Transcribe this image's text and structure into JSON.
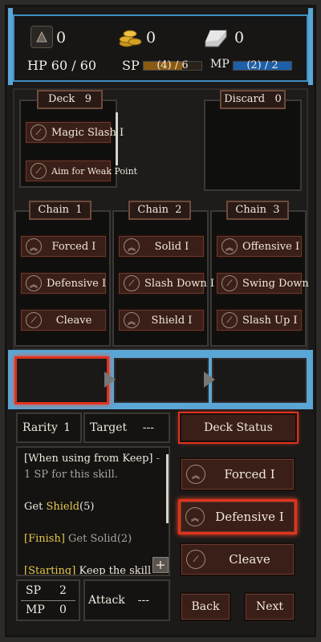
{
  "resources": {
    "gems": "0",
    "coins": "0",
    "ingots": "0"
  },
  "stats": {
    "hp_label": "HP 60 / 60",
    "sp_label": "SP",
    "sp_value": "(4) / 6",
    "sp_fill": 0.67,
    "mp_label": "MP",
    "mp_value": "(2) / 2",
    "mp_fill": 1.0,
    "colors": {
      "sp_bar": "#8a5a12",
      "mp_bar": "#1d5fa8",
      "highlight": "#e0321e",
      "frame": "#5aa6d6"
    }
  },
  "deck": {
    "label": "Deck",
    "count": "9",
    "cards": [
      {
        "name": "Magic Slash I",
        "icon": "slash-icon"
      },
      {
        "name": "Aim for Weak Point",
        "icon": "slash-icon"
      }
    ]
  },
  "discard": {
    "label": "Discard",
    "count": "0"
  },
  "chains": [
    {
      "label": "Chain",
      "num": "1",
      "cards": [
        {
          "name": "Forced I",
          "icon": "chevron-up-icon"
        },
        {
          "name": "Defensive I",
          "icon": "chevron-up-icon"
        },
        {
          "name": "Cleave",
          "icon": "slash-icon"
        }
      ]
    },
    {
      "label": "Chain",
      "num": "2",
      "cards": [
        {
          "name": "Solid I",
          "icon": "chevron-up-icon"
        },
        {
          "name": "Slash Down I",
          "icon": "slash-icon"
        },
        {
          "name": "Shield I",
          "icon": "chevron-up-icon"
        }
      ]
    },
    {
      "label": "Chain",
      "num": "3",
      "cards": [
        {
          "name": "Offensive I",
          "icon": "chevron-up-icon"
        },
        {
          "name": "Swing Down",
          "icon": "slash-icon"
        },
        {
          "name": "Slash Up I",
          "icon": "slash-icon"
        }
      ]
    }
  ],
  "info": {
    "rarity_label": "Rarity",
    "rarity_value": "1",
    "target_label": "Target",
    "target_value": "---",
    "sp_label": "SP",
    "sp_value": "2",
    "mp_label": "MP",
    "mp_value": "0",
    "attack_label": "Attack",
    "attack_value": "---"
  },
  "description": {
    "line1": "[When using from Keep]",
    "line1_suffix": "-",
    "line2": "1 SP for this skill.",
    "get_prefix": "Get ",
    "get_keyword": "Shield",
    "get_suffix": "(5)",
    "finish_tag": "[Finish]",
    "finish_text": " Get Solid(2)",
    "starting_tag": "[Starting]",
    "starting_text": " Keep the skill"
  },
  "buttons": {
    "deck_status": "Deck Status",
    "back": "Back",
    "next": "Next",
    "plus": "+"
  },
  "choices": [
    {
      "name": "Forced I",
      "icon": "chevron-up-icon"
    },
    {
      "name": "Defensive I",
      "icon": "chevron-up-icon"
    },
    {
      "name": "Cleave",
      "icon": "slash-icon"
    }
  ]
}
